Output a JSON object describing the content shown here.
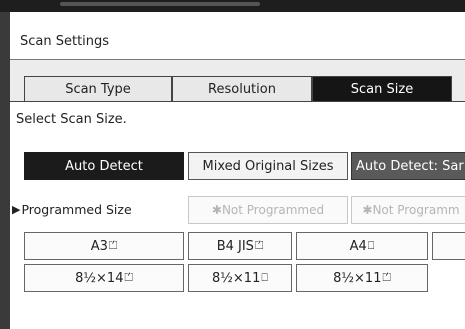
{
  "window": {
    "title": "Scan Settings"
  },
  "tabs": [
    {
      "label": "Scan Type",
      "active": false
    },
    {
      "label": "Resolution",
      "active": false
    },
    {
      "label": "Scan Size",
      "active": true
    }
  ],
  "prompt": "Select Scan Size.",
  "detect_buttons": [
    {
      "label": "Auto Detect",
      "selected": true
    },
    {
      "label": "Mixed Original Sizes",
      "selected": false
    },
    {
      "label": "Auto Detect: Sar",
      "selected": false
    }
  ],
  "programmed": {
    "label": "Programmed Size",
    "arrow_icon": "right-triangle-icon",
    "slots": [
      {
        "star": "✱",
        "label": "Not Programmed"
      },
      {
        "star": "✱",
        "label": "Not Programm"
      }
    ]
  },
  "sizes_row1": [
    {
      "label": "A3",
      "orient": "landscape-icon",
      "glyph": "⏍"
    },
    {
      "label": "B4 JIS",
      "orient": "landscape-icon",
      "glyph": "⏍"
    },
    {
      "label": "A4",
      "orient": "portrait-icon",
      "glyph": "⎕"
    }
  ],
  "sizes_row2": [
    {
      "label": "8½×14",
      "orient": "landscape-icon",
      "glyph": "⏍"
    },
    {
      "label": "8½×11",
      "orient": "portrait-icon",
      "glyph": "⎕"
    },
    {
      "label": "8½×11",
      "orient": "landscape-icon",
      "glyph": "⏍"
    }
  ],
  "colors": {
    "selected": "#1b1b1b",
    "tab_active": "#151515",
    "disabled_text": "#b5b5b5"
  }
}
